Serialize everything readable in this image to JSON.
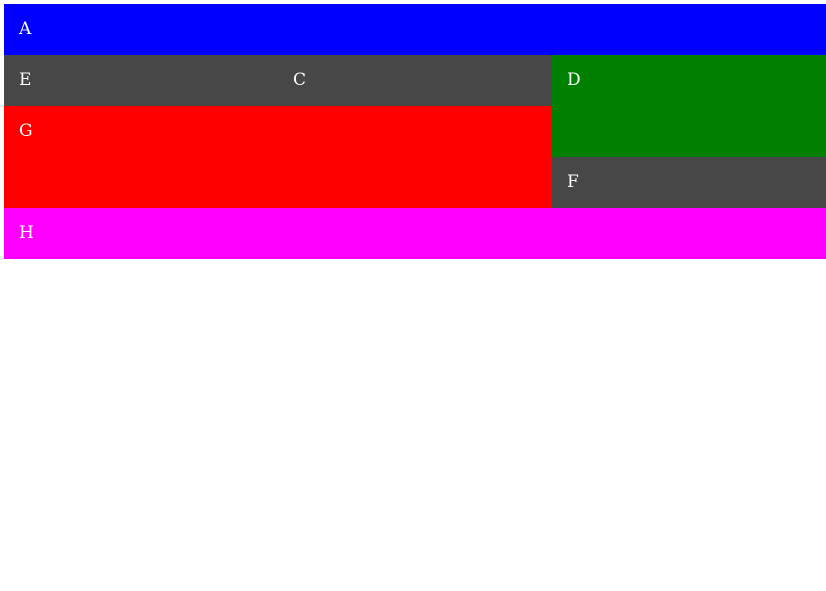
{
  "cells": {
    "a": {
      "label": "A",
      "color": "#0000ff"
    },
    "e": {
      "label": "E",
      "color": "#474747"
    },
    "c": {
      "label": "C",
      "color": "#474747"
    },
    "d": {
      "label": "D",
      "color": "#008000"
    },
    "g": {
      "label": "G",
      "color": "#ff0000"
    },
    "f": {
      "label": "F",
      "color": "#474747"
    },
    "h": {
      "label": "H",
      "color": "#ff00ff"
    }
  }
}
